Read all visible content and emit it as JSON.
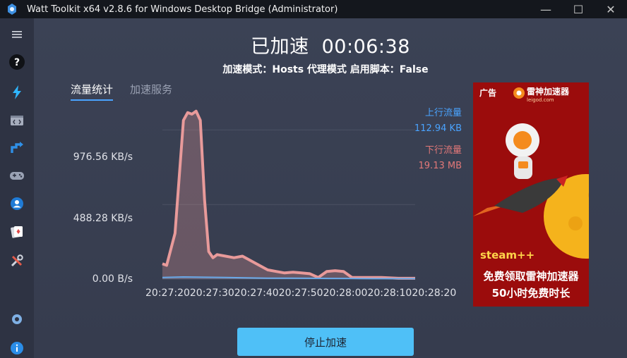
{
  "window": {
    "title": "Watt Toolkit x64 v2.8.6 for Windows Desktop Bridge (Administrator)",
    "minimize_icon": "—",
    "maximize_icon": "☐",
    "close_icon": "✕"
  },
  "sidebar": {
    "items": [
      {
        "icon": "menu-icon"
      },
      {
        "icon": "help-icon"
      },
      {
        "icon": "lightning-icon"
      },
      {
        "icon": "code-window-icon"
      },
      {
        "icon": "arrows-icon"
      },
      {
        "icon": "gamepad-icon"
      },
      {
        "icon": "user-icon"
      },
      {
        "icon": "cards-icon"
      },
      {
        "icon": "tools-icon"
      },
      {
        "icon": "settings-icon"
      },
      {
        "icon": "info-icon"
      }
    ]
  },
  "status": {
    "state": "已加速",
    "timer": "00:06:38"
  },
  "info": {
    "text": "加速模式：Hosts 代理模式   启用脚本：False"
  },
  "tabs": [
    {
      "label": "流量统计",
      "active": true
    },
    {
      "label": "加速服务",
      "active": false
    }
  ],
  "legend": {
    "upload_label": "上行流量",
    "upload_value": "112.94 KB",
    "download_label": "下行流量",
    "download_value": "19.13 MB"
  },
  "chart_data": {
    "type": "area",
    "x_ticks": [
      "20:27:20",
      "20:27:30",
      "20:27:40",
      "20:27:50",
      "20:28:00",
      "20:28:10",
      "20:28:20"
    ],
    "y_ticks": [
      "0.00 B/s",
      "488.28 KB/s",
      "976.56 KB/s"
    ],
    "ylim": [
      0,
      1200
    ],
    "xlim": [
      0,
      60
    ],
    "grid": true,
    "series": [
      {
        "name": "下行流量",
        "color": "#e89a9a",
        "points": [
          [
            0,
            100
          ],
          [
            1,
            90
          ],
          [
            3,
            300
          ],
          [
            5,
            1040
          ],
          [
            6,
            1090
          ],
          [
            7,
            1080
          ],
          [
            8,
            1100
          ],
          [
            9,
            1040
          ],
          [
            10,
            520
          ],
          [
            11,
            180
          ],
          [
            12,
            140
          ],
          [
            13,
            160
          ],
          [
            15,
            150
          ],
          [
            17,
            140
          ],
          [
            19,
            150
          ],
          [
            21,
            120
          ],
          [
            23,
            90
          ],
          [
            25,
            60
          ],
          [
            27,
            50
          ],
          [
            29,
            40
          ],
          [
            31,
            45
          ],
          [
            33,
            40
          ],
          [
            35,
            35
          ],
          [
            37,
            10
          ],
          [
            39,
            50
          ],
          [
            41,
            55
          ],
          [
            43,
            50
          ],
          [
            45,
            10
          ],
          [
            48,
            10
          ],
          [
            52,
            10
          ],
          [
            56,
            5
          ],
          [
            60,
            5
          ]
        ]
      },
      {
        "name": "上行流量",
        "color": "#6aa9e8",
        "points": [
          [
            0,
            10
          ],
          [
            5,
            14
          ],
          [
            10,
            12
          ],
          [
            15,
            10
          ],
          [
            20,
            8
          ],
          [
            25,
            6
          ],
          [
            30,
            6
          ],
          [
            35,
            5
          ],
          [
            40,
            4
          ],
          [
            45,
            4
          ],
          [
            50,
            3
          ],
          [
            55,
            3
          ],
          [
            60,
            3
          ]
        ]
      }
    ]
  },
  "stop_button": {
    "label": "停止加速"
  },
  "ad": {
    "tag": "广告",
    "brand": "雷神加速器",
    "brand_url": "leigod.com",
    "steam": "steam++",
    "line1": "免费领取雷神加速器",
    "line2": "50小时免费时长"
  }
}
